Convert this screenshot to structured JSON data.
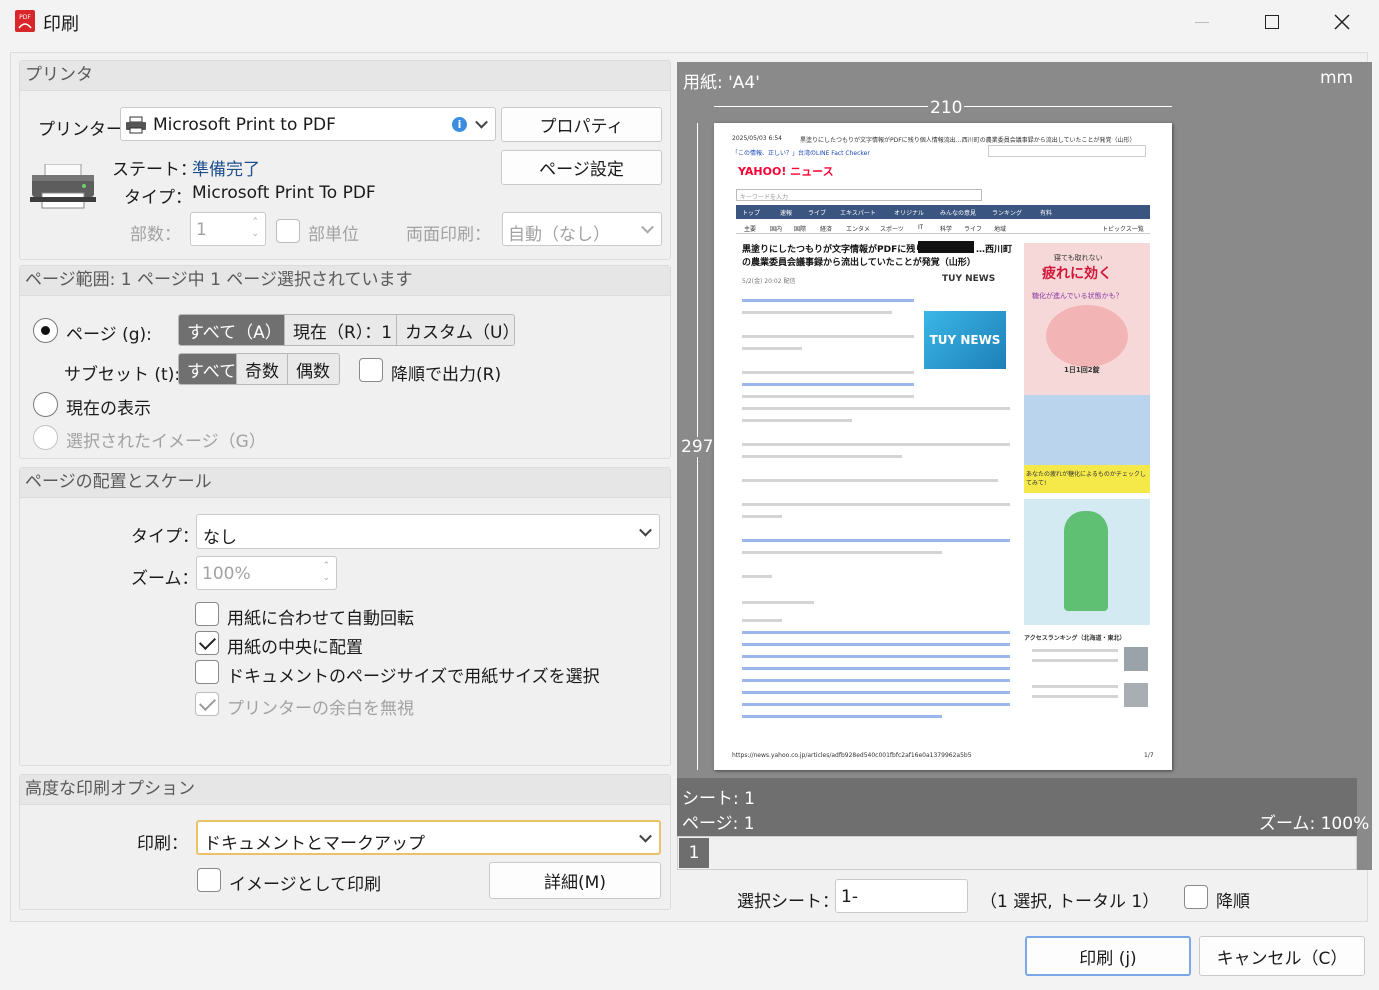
{
  "window": {
    "title": "印刷",
    "app_icon_text": "PDF"
  },
  "printer_group": {
    "header": "プリンタ",
    "printer_label": "プリンター...",
    "printer_value": "Microsoft Print to PDF",
    "properties_button": "プロパティ",
    "page_setup_button": "ページ設定",
    "state_label": "ステート：",
    "state_value": "準備完了",
    "type_label": "タイプ：",
    "type_value": "Microsoft Print To PDF",
    "copies_label": "部数：",
    "copies_value": "1",
    "collate_label": "部単位",
    "duplex_label": "両面印刷：",
    "duplex_value": "自動（なし）"
  },
  "range_group": {
    "header": "ページ範囲: 1 ページ中 1 ページ選択されています",
    "pages_label": "ページ (g):",
    "pages_options": [
      "すべて（A）",
      "現在（R）：1",
      "カスタム（U）"
    ],
    "subset_label": "サブセット (t):",
    "subset_options": [
      "すべて",
      "奇数",
      "偶数"
    ],
    "reverse_label": "降順で出力(R)",
    "current_view_label": "現在の表示",
    "selected_image_label": "選択されたイメージ（G）"
  },
  "scale_group": {
    "header": "ページの配置とスケール",
    "type_label": "タイプ：",
    "type_value": "なし",
    "zoom_label": "ズーム：",
    "zoom_value": "100%",
    "auto_rotate_label": "用紙に合わせて自動回転",
    "center_label": "用紙の中央に配置",
    "choose_paper_label": "ドキュメントのページサイズで用紙サイズを選択",
    "ignore_margin_label": "プリンターの余白を無視"
  },
  "advanced_group": {
    "header": "高度な印刷オプション",
    "print_label": "印刷：",
    "print_value": "ドキュメントとマークアップ",
    "as_image_label": "イメージとして印刷",
    "details_button": "詳細(M)"
  },
  "preview": {
    "paper_label": "用紙: 'A4'",
    "unit": "mm",
    "width_mm": "210",
    "height_mm": "297",
    "sheet_label": "シート: 1",
    "page_label": "ページ: 1",
    "zoom_label": "ズーム: 100%",
    "tab_number": "1",
    "doc": {
      "date": "2025/05/03 6:54",
      "headline_top": "黒塗りにしたつもりが文字情報がPDFに残り個人情報流出…西川町の農業委員会議事録から流出していたことが発覚（山形）",
      "fact_check": "「この情報、正しい？」台湾のLINE Fact Checker",
      "logo": "YAHOO! ニュース",
      "search_placeholder": "キーワードを入力",
      "nav": [
        "トップ",
        "速報",
        "ライブ",
        "エキスパート",
        "オリジナル",
        "みんなの意見",
        "ランキング",
        "有料"
      ],
      "subnav": [
        "主要",
        "国内",
        "国際",
        "経済",
        "エンタメ",
        "スポーツ",
        "IT",
        "科学",
        "ライフ",
        "地域"
      ],
      "topics": "トピックス一覧",
      "article_title_1": "黒塗りにしたつもりが文字情報がPDFに残り",
      "article_title_1b": "…西川町",
      "article_title_2": "の農業委員会議事録から流出していたことが発覚（山形）",
      "article_meta": "5/2(金) 20:02 配信",
      "source": "TUY NEWS",
      "ad_text_1": "寝ても取れない",
      "ad_text_2": "疲れに効く",
      "ad_text_3": "糖化が進んでいる状態かも？",
      "ad_text_4": "1日1回2錠",
      "ad_text_5": "あなたの疲れが糖化によるものかチェックしてみて!",
      "ranking_title": "アクセスランキング（北海道・東北）",
      "url": "https://news.yahoo.co.jp/articles/adfb928ed540c001fbfc2af16e0a1379962a5b5",
      "page_num": "1/7"
    }
  },
  "sheet_select": {
    "label": "選択シート：",
    "value": "1-",
    "info": "（1 選択, トータル 1）",
    "reverse_label": "降順"
  },
  "footer": {
    "print_button": "印刷 (j)",
    "cancel_button": "キャンセル（C）"
  }
}
